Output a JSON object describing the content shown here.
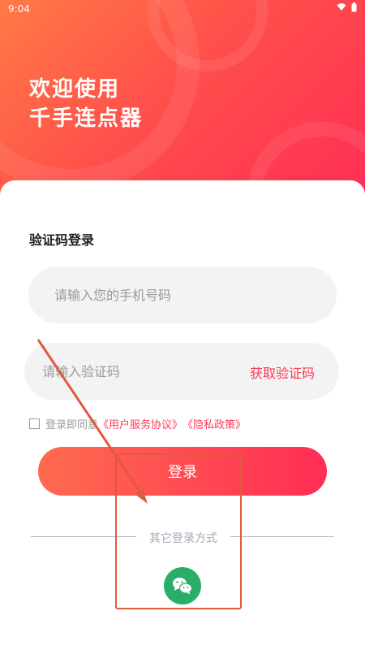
{
  "status_bar": {
    "time": "9:04",
    "icons": [
      "wifi-icon",
      "battery-icon"
    ]
  },
  "welcome": {
    "line1": "欢迎使用",
    "line2": "千手连点器"
  },
  "login": {
    "title": "验证码登录",
    "phone_placeholder": "请输入您的手机号码",
    "code_placeholder": "请输入验证码",
    "get_code": "获取验证码",
    "agree_prefix": "登录即同意",
    "user_agreement": "《用户服务协议》",
    "privacy_policy": "《隐私政策》",
    "agree_checked": false,
    "submit": "登录",
    "other_methods": "其它登录方式",
    "wechat_icon": "wechat-icon"
  },
  "colors": {
    "accent": "#ff3a55",
    "wechat": "#2aae67",
    "annotation": "#e05a3e"
  }
}
